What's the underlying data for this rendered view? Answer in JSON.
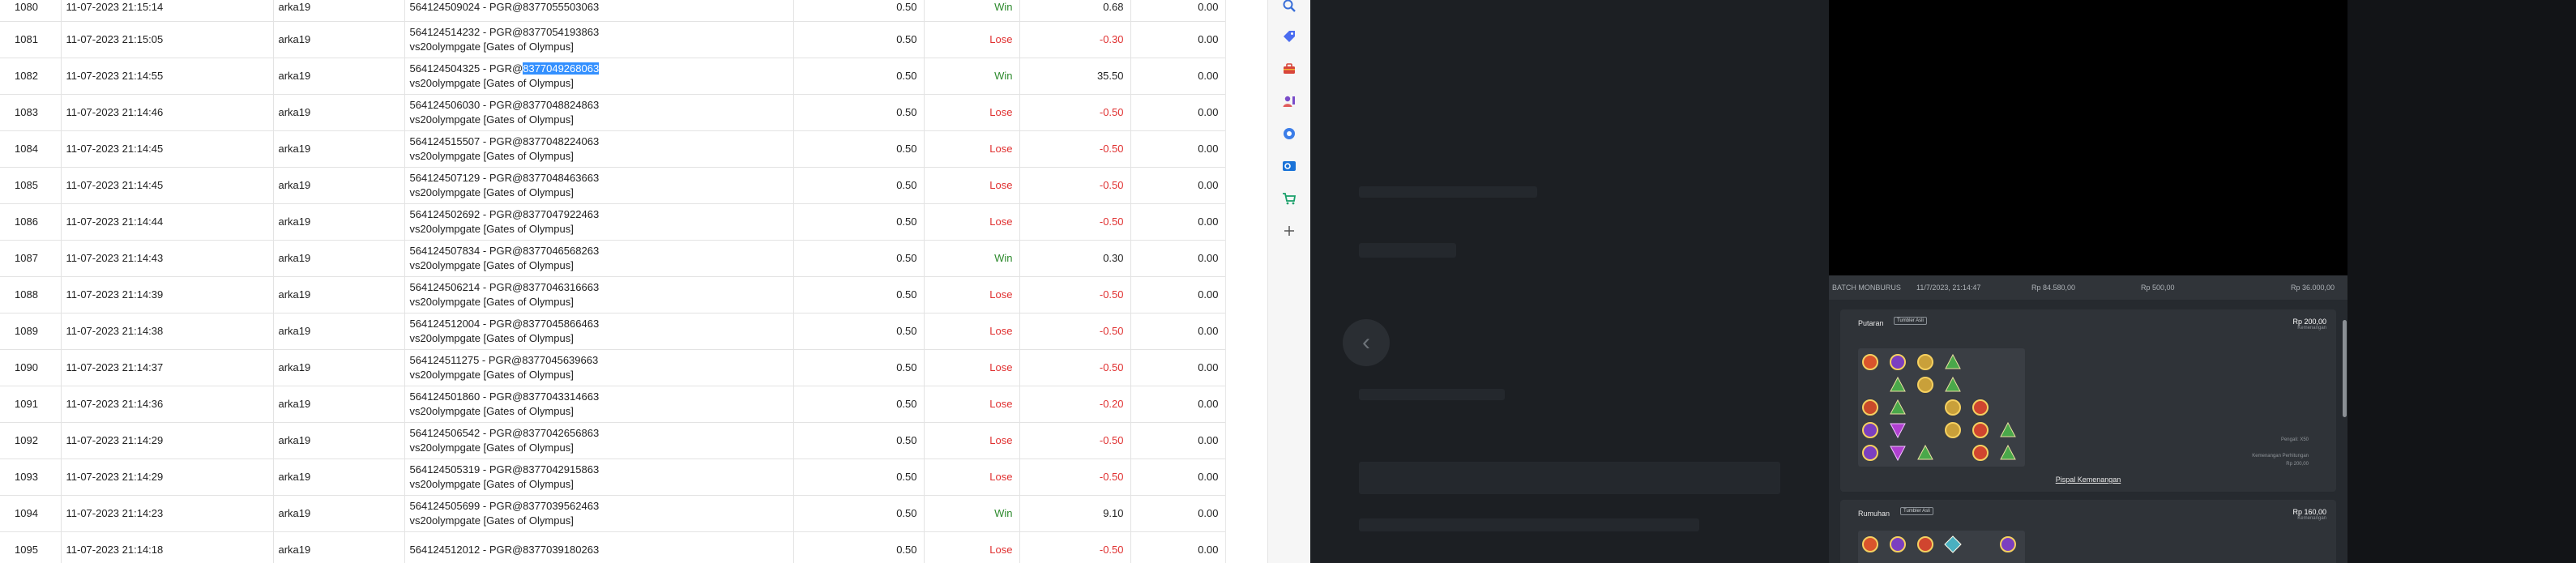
{
  "table": {
    "rows": [
      {
        "no": "1080",
        "date": "11-07-2023 21:15:14",
        "user": "arka19",
        "id": "564124509024 - PGR@8377055503063",
        "game": "",
        "bet": "0.50",
        "result": "Win",
        "win": "0.68",
        "extra": "0.00"
      },
      {
        "no": "1081",
        "date": "11-07-2023 21:15:05",
        "user": "arka19",
        "id": "564124514232 - PGR@8377054193863",
        "game": "vs20olympgate [Gates of Olympus]",
        "bet": "0.50",
        "result": "Lose",
        "win": "-0.30",
        "extra": "0.00"
      },
      {
        "no": "1082",
        "date": "11-07-2023 21:14:55",
        "user": "arka19",
        "id": "564124504325 - PGR@",
        "idsel": "8377049268063",
        "game": "vs20olympgate [Gates of Olympus]",
        "bet": "0.50",
        "result": "Win",
        "win": "35.50",
        "extra": "0.00"
      },
      {
        "no": "1083",
        "date": "11-07-2023 21:14:46",
        "user": "arka19",
        "id": "564124506030 - PGR@8377048824863",
        "game": "vs20olympgate [Gates of Olympus]",
        "bet": "0.50",
        "result": "Lose",
        "win": "-0.50",
        "extra": "0.00"
      },
      {
        "no": "1084",
        "date": "11-07-2023 21:14:45",
        "user": "arka19",
        "id": "564124515507 - PGR@8377048224063",
        "game": "vs20olympgate [Gates of Olympus]",
        "bet": "0.50",
        "result": "Lose",
        "win": "-0.50",
        "extra": "0.00"
      },
      {
        "no": "1085",
        "date": "11-07-2023 21:14:45",
        "user": "arka19",
        "id": "564124507129 - PGR@8377048463663",
        "game": "vs20olympgate [Gates of Olympus]",
        "bet": "0.50",
        "result": "Lose",
        "win": "-0.50",
        "extra": "0.00"
      },
      {
        "no": "1086",
        "date": "11-07-2023 21:14:44",
        "user": "arka19",
        "id": "564124502692 - PGR@8377047922463",
        "game": "vs20olympgate [Gates of Olympus]",
        "bet": "0.50",
        "result": "Lose",
        "win": "-0.50",
        "extra": "0.00"
      },
      {
        "no": "1087",
        "date": "11-07-2023 21:14:43",
        "user": "arka19",
        "id": "564124507834 - PGR@8377046568263",
        "game": "vs20olympgate [Gates of Olympus]",
        "bet": "0.50",
        "result": "Win",
        "win": "0.30",
        "extra": "0.00"
      },
      {
        "no": "1088",
        "date": "11-07-2023 21:14:39",
        "user": "arka19",
        "id": "564124506214 - PGR@8377046316663",
        "game": "vs20olympgate [Gates of Olympus]",
        "bet": "0.50",
        "result": "Lose",
        "win": "-0.50",
        "extra": "0.00"
      },
      {
        "no": "1089",
        "date": "11-07-2023 21:14:38",
        "user": "arka19",
        "id": "564124512004 - PGR@8377045866463",
        "game": "vs20olympgate [Gates of Olympus]",
        "bet": "0.50",
        "result": "Lose",
        "win": "-0.50",
        "extra": "0.00"
      },
      {
        "no": "1090",
        "date": "11-07-2023 21:14:37",
        "user": "arka19",
        "id": "564124511275 - PGR@8377045639663",
        "game": "vs20olympgate [Gates of Olympus]",
        "bet": "0.50",
        "result": "Lose",
        "win": "-0.50",
        "extra": "0.00"
      },
      {
        "no": "1091",
        "date": "11-07-2023 21:14:36",
        "user": "arka19",
        "id": "564124501860 - PGR@8377043314663",
        "game": "vs20olympgate [Gates of Olympus]",
        "bet": "0.50",
        "result": "Lose",
        "win": "-0.20",
        "extra": "0.00"
      },
      {
        "no": "1092",
        "date": "11-07-2023 21:14:29",
        "user": "arka19",
        "id": "564124506542 - PGR@8377042656863",
        "game": "vs20olympgate [Gates of Olympus]",
        "bet": "0.50",
        "result": "Lose",
        "win": "-0.50",
        "extra": "0.00"
      },
      {
        "no": "1093",
        "date": "11-07-2023 21:14:29",
        "user": "arka19",
        "id": "564124505319 - PGR@8377042915863",
        "game": "vs20olympgate [Gates of Olympus]",
        "bet": "0.50",
        "result": "Lose",
        "win": "-0.50",
        "extra": "0.00"
      },
      {
        "no": "1094",
        "date": "11-07-2023 21:14:23",
        "user": "arka19",
        "id": "564124505699 - PGR@8377039562463",
        "game": "vs20olympgate [Gates of Olympus]",
        "bet": "0.50",
        "result": "Win",
        "win": "9.10",
        "extra": "0.00"
      },
      {
        "no": "1095",
        "date": "11-07-2023 21:14:18",
        "user": "arka19",
        "id": "564124512012 - PGR@8377039180263",
        "game": "",
        "bet": "0.50",
        "result": "Lose",
        "win": "-0.50",
        "extra": "0.00"
      }
    ]
  },
  "sidebar_icons": [
    "search-icon",
    "tag-icon",
    "toolbox-icon",
    "person-icon",
    "gear-icon",
    "outlook-icon",
    "cart-icon",
    "plus-icon"
  ],
  "modal": {
    "summary": {
      "label": "BATCH MONBURUS",
      "datetime": "11/7/2023, 21:14:47",
      "total": "Rp 84.580,00",
      "bet": "Rp 500,00",
      "win": "Rp 36.000,00"
    },
    "card1": {
      "title": "Putaran",
      "badge": "Tumbler Asli",
      "amount": "Rp 200,00",
      "amount_sub": "Kemenangan",
      "note1": "Pengali: X50",
      "note2": "Kemenangan Perhitungan",
      "note3": "Rp 200,00",
      "link": "Pispal Kemenangan"
    },
    "card2": {
      "title": "Rumuhan",
      "badge": "Tumbler Asli",
      "amount": "Rp 160,00",
      "amount_sub": "Kemenangan"
    }
  },
  "colors": {
    "win": "#2e8b2e",
    "lose": "#e03030",
    "selection": "#3390ff",
    "modal_bg": "#262a2f"
  }
}
